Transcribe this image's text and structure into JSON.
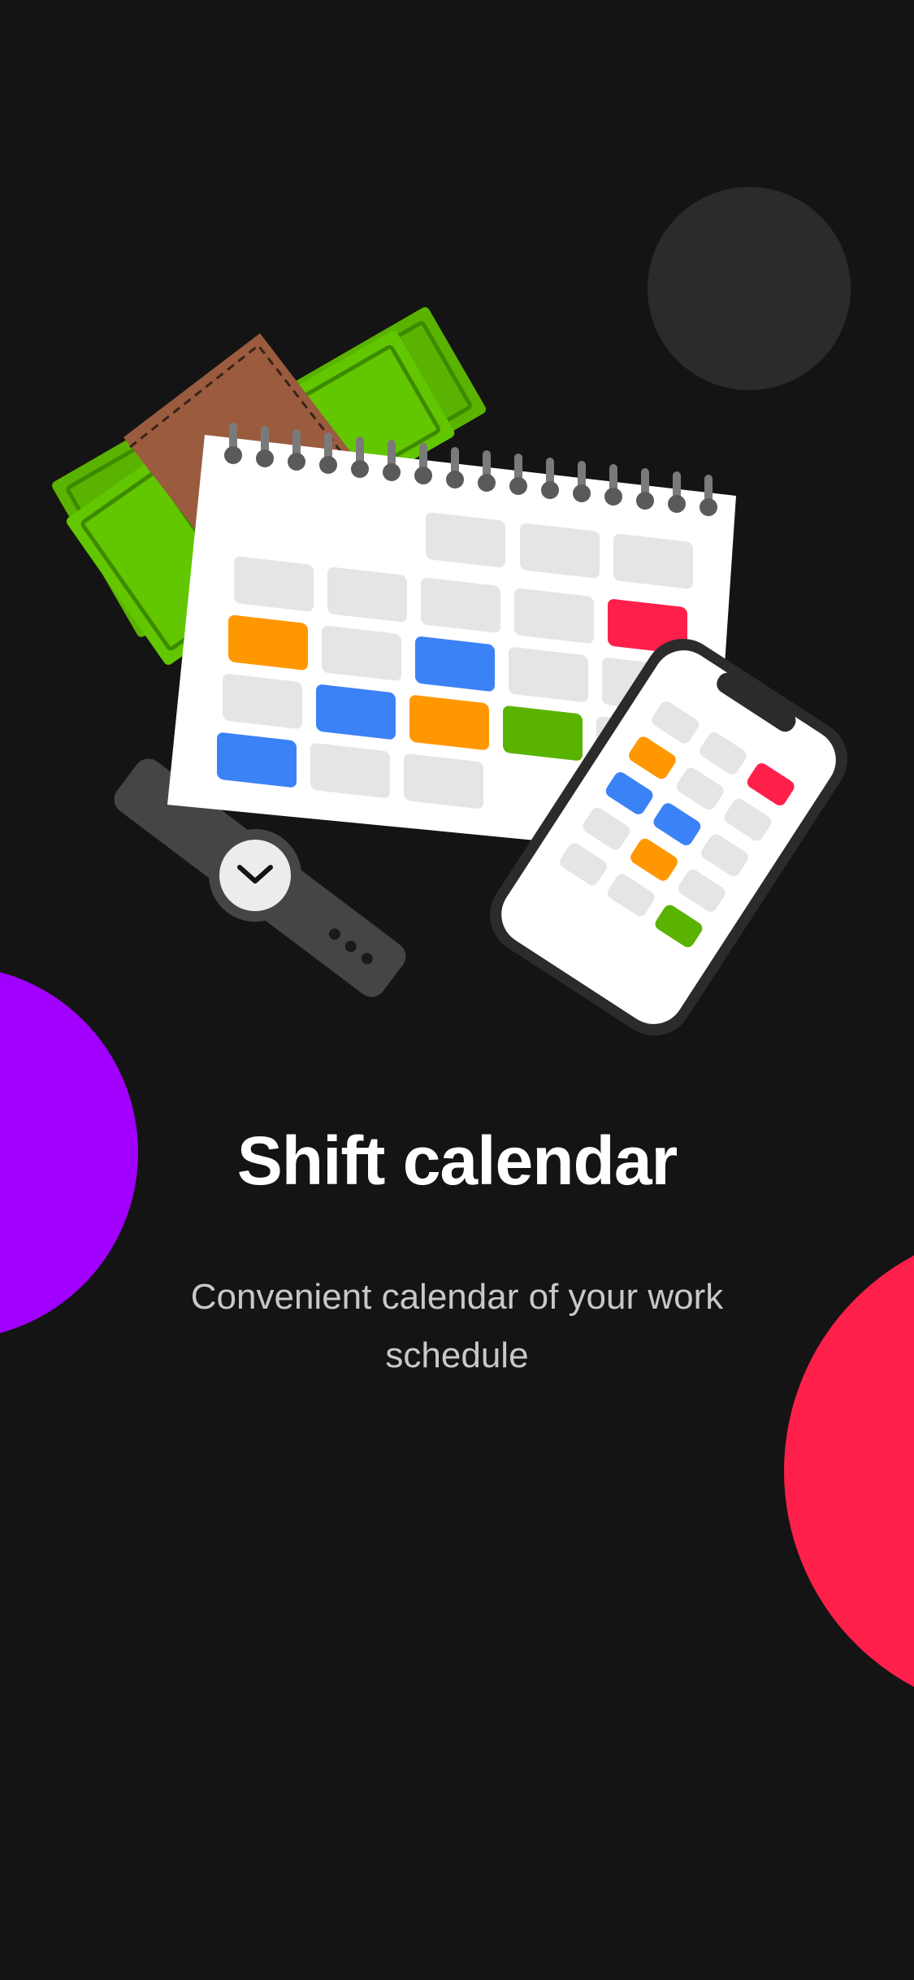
{
  "onboarding": {
    "title": "Shift calendar",
    "subtitle": "Convenient calendar of your work schedule"
  },
  "illustration": {
    "icons": [
      "wallet-icon",
      "money-icon",
      "calendar-icon",
      "watch-icon",
      "phone-icon"
    ]
  },
  "colors": {
    "background": "#141414",
    "orange": "#FF9800",
    "blue": "#3B82F6",
    "green": "#5AB300",
    "red": "#FF1F4B",
    "purple": "#A100FF",
    "grey_cell": "#E5E5E5",
    "wallet": "#9A5B3E",
    "watch": "#454545"
  }
}
